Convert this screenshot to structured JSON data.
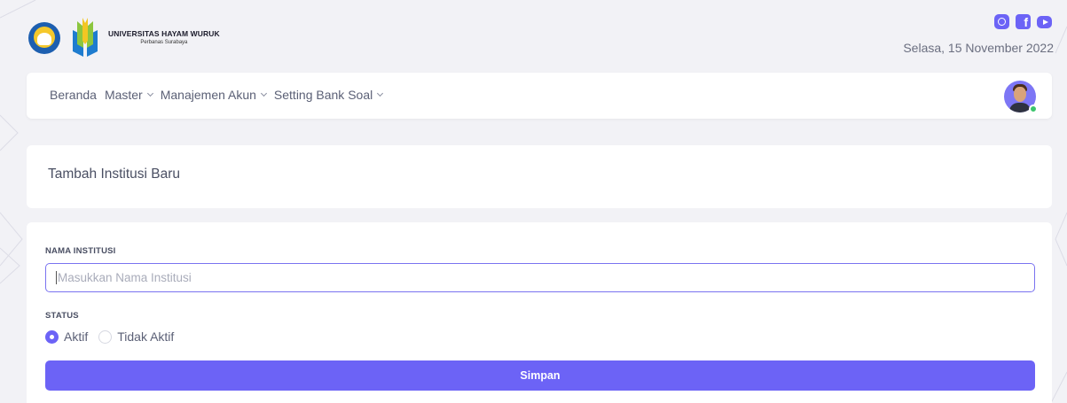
{
  "header": {
    "university_name": "UNIVERSITAS HAYAM WURUK",
    "university_sub": "Perbanas Surabaya",
    "date": "Selasa, 15 November 2022",
    "social_icons": [
      "instagram-icon",
      "facebook-icon",
      "youtube-icon"
    ],
    "facebook_glyph": "f"
  },
  "nav": {
    "items": [
      {
        "label": "Beranda",
        "has_dropdown": false
      },
      {
        "label": "Master",
        "has_dropdown": true
      },
      {
        "label": "Manajemen Akun",
        "has_dropdown": true
      },
      {
        "label": "Setting Bank Soal",
        "has_dropdown": true
      }
    ],
    "user_status": "online"
  },
  "page": {
    "title": "Tambah Institusi Baru"
  },
  "form": {
    "name_label": "NAMA INSTITUSI",
    "name_placeholder": "Masukkan Nama Institusi",
    "name_value": "",
    "status_label": "STATUS",
    "status_options": [
      {
        "label": "Aktif",
        "selected": true
      },
      {
        "label": "Tidak Aktif",
        "selected": false
      }
    ],
    "submit_label": "Simpan"
  },
  "colors": {
    "accent": "#6c63f6",
    "background": "#f2f2f6",
    "card": "#ffffff",
    "online": "#3bc46c"
  }
}
